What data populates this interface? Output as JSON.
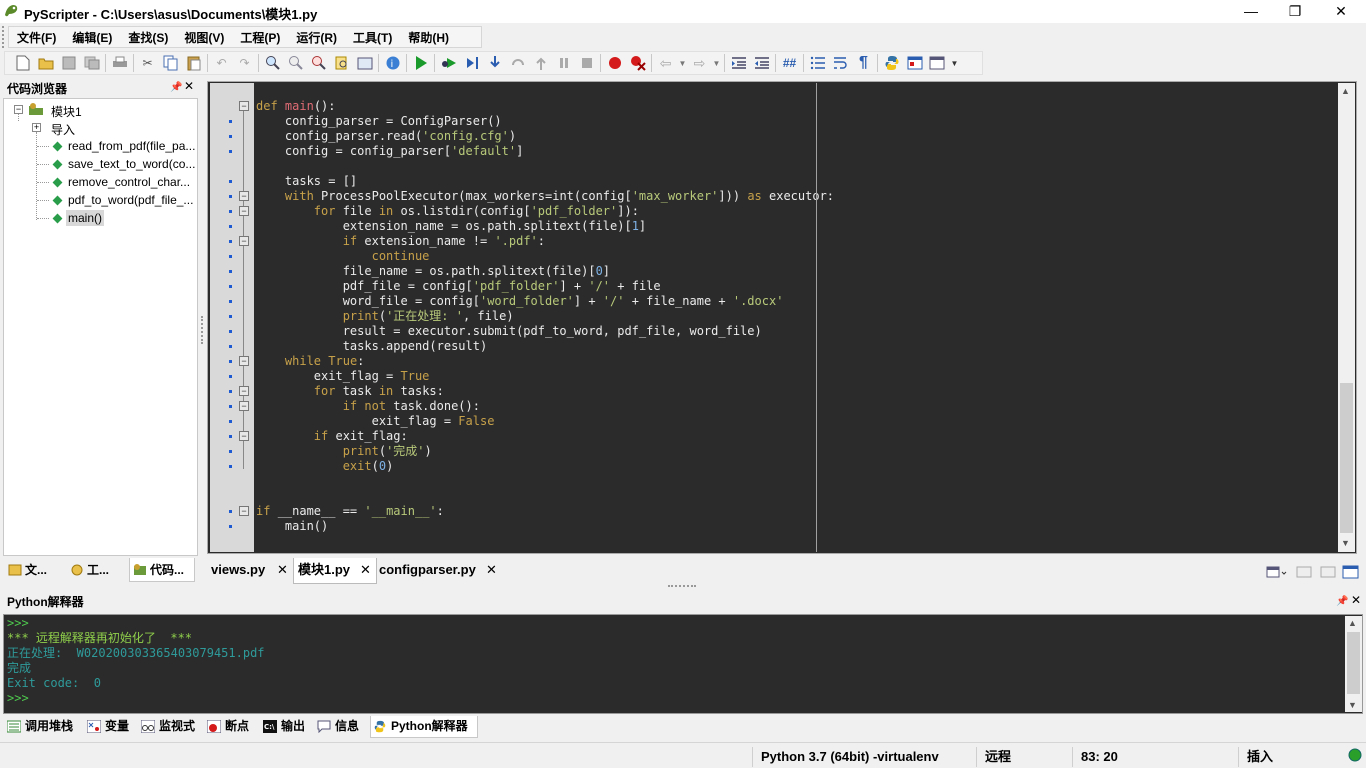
{
  "window": {
    "title": "PyScripter - C:\\Users\\asus\\Documents\\模块1.py",
    "minimize": "—",
    "maximize": "❐",
    "close": "✕"
  },
  "menu": [
    "文件(F)",
    "编辑(E)",
    "查找(S)",
    "视图(V)",
    "工程(P)",
    "运行(R)",
    "工具(T)",
    "帮助(H)"
  ],
  "toolbar_icons": [
    "new-file",
    "open-file",
    "save",
    "save-all",
    "print",
    "cut",
    "copy",
    "paste",
    "undo",
    "redo",
    "find",
    "find-next",
    "replace",
    "find-in-files",
    "zoom",
    "help",
    "run",
    "debug",
    "step-into",
    "step-over",
    "step-out",
    "run-to-cursor",
    "pause",
    "stop",
    "toggle-breakpoint",
    "clear-breakpoints",
    "back",
    "forward",
    "indent",
    "dedent",
    "comment",
    "list",
    "wrap",
    "pilcrow",
    "python",
    "interpreter",
    "layout"
  ],
  "left_panel": {
    "title": "代码浏览器",
    "pin": "📌",
    "close": "✕",
    "tree": {
      "root": "模块1",
      "imports": "导入",
      "functions": [
        "read_from_pdf(file_pa...",
        "save_text_to_word(co...",
        "remove_control_char...",
        "pdf_to_word(pdf_file_...",
        "main()"
      ]
    },
    "tabs": [
      "文...",
      "工...",
      "代码..."
    ]
  },
  "editor": {
    "lines": [
      [
        [
          "def ",
          "kw"
        ],
        [
          "main",
          "fn"
        ],
        [
          "():",
          "d"
        ]
      ],
      [
        [
          "    config_parser = ConfigParser()",
          "d"
        ]
      ],
      [
        [
          "    config_parser.read(",
          "d"
        ],
        [
          "'config.cfg'",
          "str"
        ],
        [
          ")",
          "d"
        ]
      ],
      [
        [
          "    config = config_parser[",
          "d"
        ],
        [
          "'default'",
          "str"
        ],
        [
          "]",
          "d"
        ]
      ],
      [
        [
          "",
          "d"
        ]
      ],
      [
        [
          "    tasks = []",
          "d"
        ]
      ],
      [
        [
          "    ",
          "d"
        ],
        [
          "with ",
          "kw"
        ],
        [
          "ProcessPoolExecutor(max_workers=int(config[",
          "d"
        ],
        [
          "'max_worker'",
          "str"
        ],
        [
          "])) ",
          "d"
        ],
        [
          "as ",
          "kw"
        ],
        [
          "executor:",
          "d"
        ]
      ],
      [
        [
          "        ",
          "d"
        ],
        [
          "for ",
          "kw"
        ],
        [
          "file ",
          "d"
        ],
        [
          "in ",
          "kw"
        ],
        [
          "os.listdir(config[",
          "d"
        ],
        [
          "'pdf_folder'",
          "str"
        ],
        [
          "]):",
          "d"
        ]
      ],
      [
        [
          "            extension_name = os.path.splitext(file)[",
          "d"
        ],
        [
          "1",
          "num"
        ],
        [
          "]",
          "d"
        ]
      ],
      [
        [
          "            ",
          "d"
        ],
        [
          "if ",
          "kw"
        ],
        [
          "extension_name != ",
          "d"
        ],
        [
          "'.pdf'",
          "str"
        ],
        [
          ":",
          "d"
        ]
      ],
      [
        [
          "                ",
          "d"
        ],
        [
          "continue",
          "kw"
        ]
      ],
      [
        [
          "            file_name = os.path.splitext(file)[",
          "d"
        ],
        [
          "0",
          "num"
        ],
        [
          "]",
          "d"
        ]
      ],
      [
        [
          "            pdf_file = config[",
          "d"
        ],
        [
          "'pdf_folder'",
          "str"
        ],
        [
          "] + ",
          "d"
        ],
        [
          "'/'",
          "str"
        ],
        [
          " + file",
          "d"
        ]
      ],
      [
        [
          "            word_file = config[",
          "d"
        ],
        [
          "'word_folder'",
          "str"
        ],
        [
          "] + ",
          "d"
        ],
        [
          "'/'",
          "str"
        ],
        [
          " + file_name + ",
          "d"
        ],
        [
          "'.docx'",
          "str"
        ]
      ],
      [
        [
          "            ",
          "d"
        ],
        [
          "print",
          "kw"
        ],
        [
          "(",
          "d"
        ],
        [
          "'正在处理: '",
          "str"
        ],
        [
          ", file)",
          "d"
        ]
      ],
      [
        [
          "            result = executor.submit(pdf_to_word, pdf_file, word_file)",
          "d"
        ]
      ],
      [
        [
          "            tasks.append(result)",
          "d"
        ]
      ],
      [
        [
          "    ",
          "d"
        ],
        [
          "while ",
          "kw"
        ],
        [
          "True",
          "kw"
        ],
        [
          ":",
          "d"
        ]
      ],
      [
        [
          "        exit_flag = ",
          "d"
        ],
        [
          "True",
          "kw"
        ]
      ],
      [
        [
          "        ",
          "d"
        ],
        [
          "for ",
          "kw"
        ],
        [
          "task ",
          "d"
        ],
        [
          "in ",
          "kw"
        ],
        [
          "tasks:",
          "d"
        ]
      ],
      [
        [
          "            ",
          "d"
        ],
        [
          "if not ",
          "kw"
        ],
        [
          "task.done():",
          "d"
        ]
      ],
      [
        [
          "                exit_flag = ",
          "d"
        ],
        [
          "False",
          "kw"
        ]
      ],
      [
        [
          "        ",
          "d"
        ],
        [
          "if ",
          "kw"
        ],
        [
          "exit_flag:",
          "d"
        ]
      ],
      [
        [
          "            ",
          "d"
        ],
        [
          "print",
          "kw"
        ],
        [
          "(",
          "d"
        ],
        [
          "'完成'",
          "str"
        ],
        [
          ")",
          "d"
        ]
      ],
      [
        [
          "            ",
          "d"
        ],
        [
          "exit",
          "kw"
        ],
        [
          "(",
          "d"
        ],
        [
          "0",
          "num"
        ],
        [
          ")",
          "d"
        ]
      ],
      [
        [
          "",
          "d"
        ]
      ],
      [
        [
          "",
          "d"
        ]
      ],
      [
        [
          "if ",
          "kw"
        ],
        [
          "__name__ == ",
          "d"
        ],
        [
          "'__main__'",
          "str"
        ],
        [
          ":",
          "d"
        ]
      ],
      [
        [
          "    main()",
          "d"
        ]
      ]
    ],
    "colors": {
      "kw": "#c7a14a",
      "fn": "#e06c75",
      "str": "#b8c97a",
      "num": "#7fb2e5",
      "d": "#ebebeb",
      "bg": "#2b2b2b"
    },
    "tabs": [
      "views.py",
      "模块1.py",
      "configparser.py"
    ],
    "tab_close": "✕"
  },
  "bottom_panel": {
    "title": "Python解释器",
    "pin": "📌",
    "close": "✕",
    "console": [
      {
        "text": ">>>",
        "color": "#4ec94e"
      },
      {
        "text": "*** 远程解释器再初始化了  ***",
        "color": "#8fcf4b"
      },
      {
        "text": "正在处理:  W020200303365403079451.pdf",
        "color": "#2f9a9a"
      },
      {
        "text": "完成",
        "color": "#2f9a9a"
      },
      {
        "text": "Exit code:  0",
        "color": "#2f9a9a"
      },
      {
        "text": ">>>",
        "color": "#4ec94e"
      }
    ],
    "tabs": [
      "调用堆栈",
      "变量",
      "监视式",
      "断点",
      "输出",
      "信息",
      "Python解释器"
    ]
  },
  "status": {
    "python": "Python 3.7 (64bit) -virtualenv",
    "mode": "远程",
    "position": "83: 20",
    "insert": "插入"
  }
}
